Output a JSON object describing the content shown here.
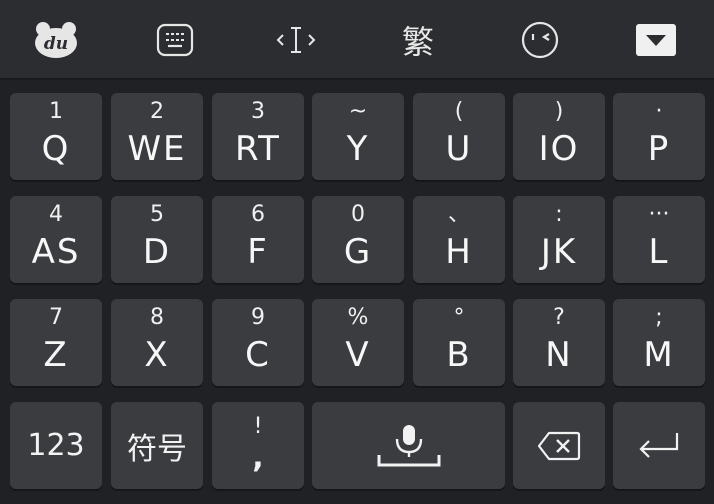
{
  "toolbar": {
    "logo_text": "du",
    "traditional_label": "繁"
  },
  "rows": [
    [
      {
        "top": "1",
        "main": "Q"
      },
      {
        "top": "2",
        "main": "WE"
      },
      {
        "top": "3",
        "main": "RT"
      },
      {
        "top": "~",
        "main": "Y"
      },
      {
        "top": "(",
        "main": "U"
      },
      {
        "top": ")",
        "main": "IO"
      },
      {
        "top": "·",
        "main": "P"
      }
    ],
    [
      {
        "top": "4",
        "main": "AS"
      },
      {
        "top": "5",
        "main": "D"
      },
      {
        "top": "6",
        "main": "F"
      },
      {
        "top": "0",
        "main": "G"
      },
      {
        "top": "、",
        "main": "H"
      },
      {
        "top": ":",
        "main": "JK"
      },
      {
        "top": "···",
        "main": "L"
      }
    ],
    [
      {
        "top": "7",
        "main": "Z"
      },
      {
        "top": "8",
        "main": "X"
      },
      {
        "top": "9",
        "main": "C"
      },
      {
        "top": "%",
        "main": "V"
      },
      {
        "top": "°",
        "main": "B"
      },
      {
        "top": "?",
        "main": "N"
      },
      {
        "top": ";",
        "main": "M"
      }
    ]
  ],
  "bottom": {
    "numbers_label": "123",
    "symbols_label": "符号",
    "comma_top": "!",
    "comma_main": ","
  },
  "colors": {
    "background": "#202125",
    "toolbar": "#2c2d31",
    "key": "#3b3c40",
    "text": "#f2f2f2"
  }
}
